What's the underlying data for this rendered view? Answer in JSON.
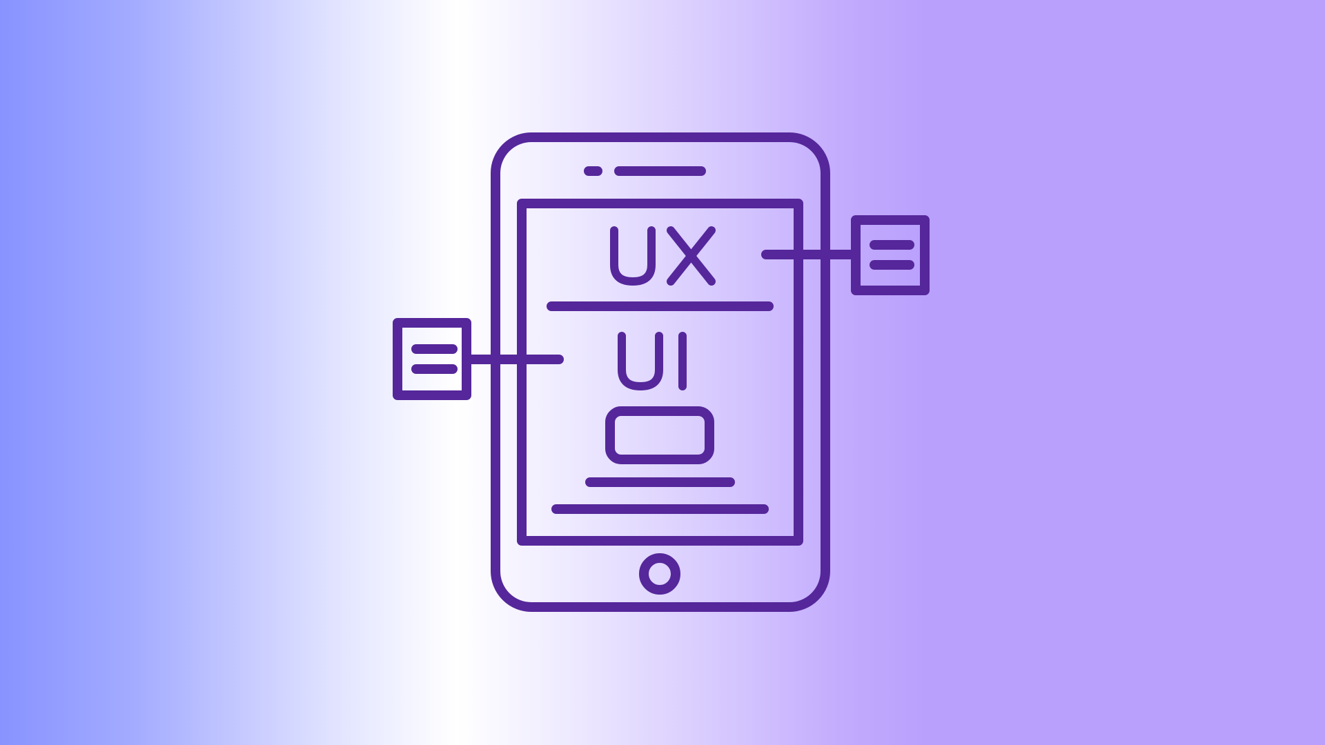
{
  "illustration": {
    "screen_heading": "UX",
    "screen_subheading": "UI",
    "icons": [
      "tablet-icon",
      "ux-text-icon",
      "ui-text-icon",
      "button-icon",
      "note-icon",
      "home-button-icon"
    ]
  },
  "colors": {
    "stroke": "#55279a",
    "background_left": "#8893ff",
    "background_center": "#ffffff",
    "background_right": "#b9a0fd"
  }
}
